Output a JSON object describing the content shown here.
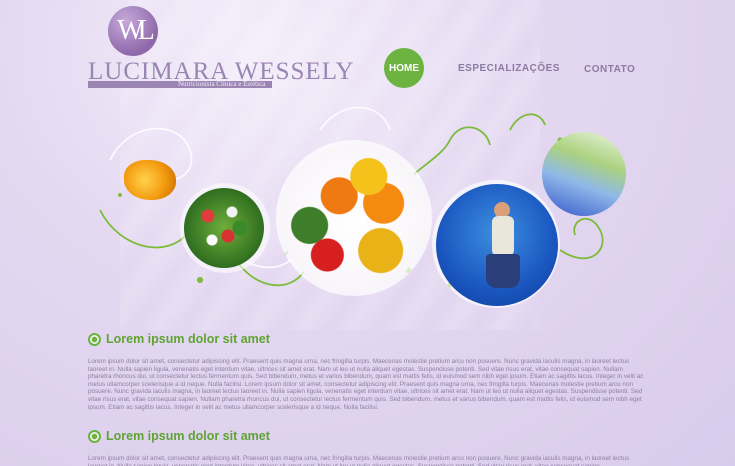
{
  "logo": {
    "monogram": "WL",
    "name": "LUCIMARA WESSELY",
    "tagline": "Nutricionista Clínica e Estética"
  },
  "nav": {
    "home": "HOME",
    "especializacoes": "ESPECIALIZAÇÕES",
    "contato": "CONTATO"
  },
  "colors": {
    "accent_green": "#6cb33f",
    "logo_purple": "#9b85b3",
    "background": "#e4d8f1"
  },
  "sections": [
    {
      "title": "Lorem ipsum dolor sit amet",
      "text": "Lorem ipsum dolor sit amet, consectetur adipiscing elit. Praesent quis magna urna, nec fringilla turpis. Maecenas molestie pretium arcu non posuere. Nunc gravida iaculis magna, in laoreet lectus laoreet in. Nulla sapien ligula, venenatis eget interdum vitae, ultrices sit amet erat. Nam ut leo ut nulla aliquet egestas. Suspendisse potenti. Sed vitae risus erat, vitae consequat sapien. Nullam pharetra rhoncus dui, ut consectetur lectus fermentum quis. Sed bibendum, metus et varius bibendum, quam est mattis felis, id euismod sem nibh eget ipsum. Etiam ac sagittis lacus. Integer in velit ac metus ullamcorper scelerisque a id neque. Nulla facilisi. Lorem ipsum dolor sit amet, consectetur adipiscing elit. Praesent quis magna urna, nec fringilla turpis. Maecenas molestie pretium arcu non posuere. Nunc gravida iaculis magna, in laoreet lectus laoreet in. Nulla sapien ligula, venenatis eget interdum vitae, ultrices sit amet erat. Nam ut leo ut nulla aliquet egestas. Suspendisse potenti. Sed vitae risus erat, vitae consequat sapien. Nullam pharetra rhoncus dui, ut consectetur lectus fermentum quis. Sed bibendum, metus et varius bibendum, quam est mattis felis, id euismod sem nibh eget ipsum. Etiam ac sagittis lacus. Integer in velit ac metus ullamcorper scelerisque a id neque. Nulla facilisi."
    },
    {
      "title": "Lorem ipsum dolor sit amet",
      "text": "Lorem ipsum dolor sit amet, consectetur adipiscing elit. Praesent quis magna urna, nec fringilla turpis. Maecenas molestie pretium arcu non posuere. Nunc gravida iaculis magna, in laoreet lectus laoreet in. Nulla sapien ligula, venenatis eget interdum vitae, ultrices sit amet erat. Nam ut leo ut nulla aliquet egestas. Suspendisse potenti. Sed vitae risus erat, vitae consequat sapien."
    }
  ]
}
